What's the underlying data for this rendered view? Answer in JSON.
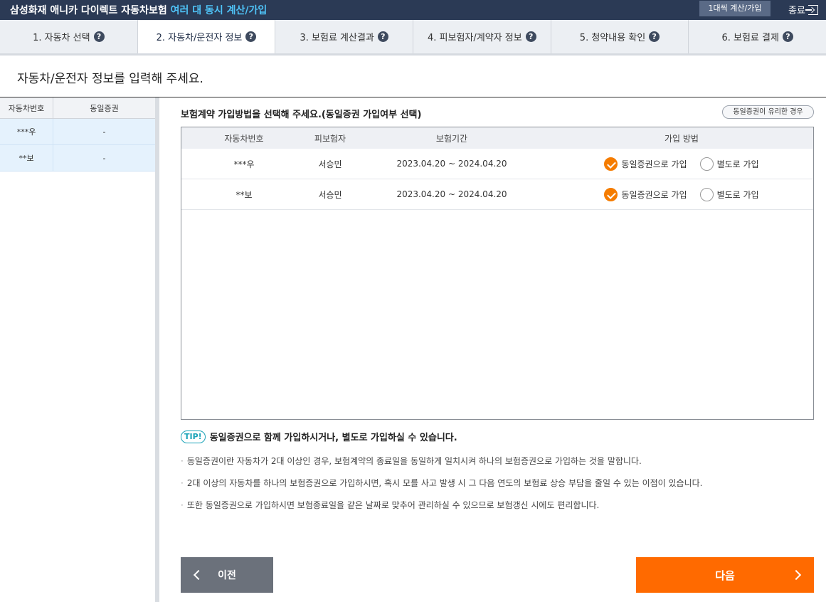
{
  "topbar": {
    "title_main": "삼성화재 애니카 다이렉트 자동차보험",
    "title_accent": "여러 대 동시 계산/가입",
    "calc_button": "1대씩 계산/가입",
    "exit_label": "종료"
  },
  "steps": [
    {
      "label": "1. 자동차 선택"
    },
    {
      "label": "2. 자동차/운전자 정보"
    },
    {
      "label": "3. 보험료 계산결과"
    },
    {
      "label": "4. 피보험자/계약자 정보"
    },
    {
      "label": "5. 청약내용 확인"
    },
    {
      "label": "6. 보험료 결제"
    }
  ],
  "help_glyph": "?",
  "page_heading": "자동차/운전자 정보를 입력해 주세요.",
  "left_panel": {
    "col1": "자동차번호",
    "col2": "동일증권",
    "rows": [
      {
        "car": "***우",
        "same": "-"
      },
      {
        "car": "**보",
        "same": "-"
      }
    ]
  },
  "main": {
    "title": "보험계약 가입방법을 선택해 주세요.(동일증권 가입여부 선택)",
    "advantage_button": "동일증권이 유리한 경우",
    "table": {
      "headers": [
        "자동차번호",
        "피보험자",
        "보험기간",
        "가입 방법"
      ],
      "rows": [
        {
          "car": "***우",
          "insured": "서승민",
          "period": "2023.04.20 ~ 2024.04.20",
          "opt1": "동일증권으로 가입",
          "opt2": "별도로 가입",
          "selected": "opt1"
        },
        {
          "car": "**보",
          "insured": "서승민",
          "period": "2023.04.20 ~ 2024.04.20",
          "opt1": "동일증권으로 가입",
          "opt2": "별도로 가입",
          "selected": "opt1"
        }
      ]
    },
    "tip_badge": "TIP!",
    "tip_text": "동일증권으로 함께 가입하시거나, 별도로 가입하실 수 있습니다.",
    "notes": [
      "동일증권이란 자동차가 2대 이상인 경우, 보험계약의 종료일을 동일하게 일치시켜 하나의 보험증권으로 가입하는 것을 말합니다.",
      "2대 이상의 자동차를 하나의 보험증권으로 가입하시면, 혹시 모를 사고 발생 시 그 다음 연도의 보험료 상승 부담을 줄일 수 있는 이점이 있습니다.",
      "또한 동일증권으로 가입하시면 보험종료일을 같은 날짜로 맞추어 관리하실 수 있으므로 보험갱신 시에도 편리합니다."
    ]
  },
  "buttons": {
    "prev": "이전",
    "next": "다음"
  },
  "colors": {
    "topbar": "#2b3a55",
    "accent": "#4fc3f7",
    "next_button": "#ff6a00",
    "radio_checked": "#f57c00"
  }
}
